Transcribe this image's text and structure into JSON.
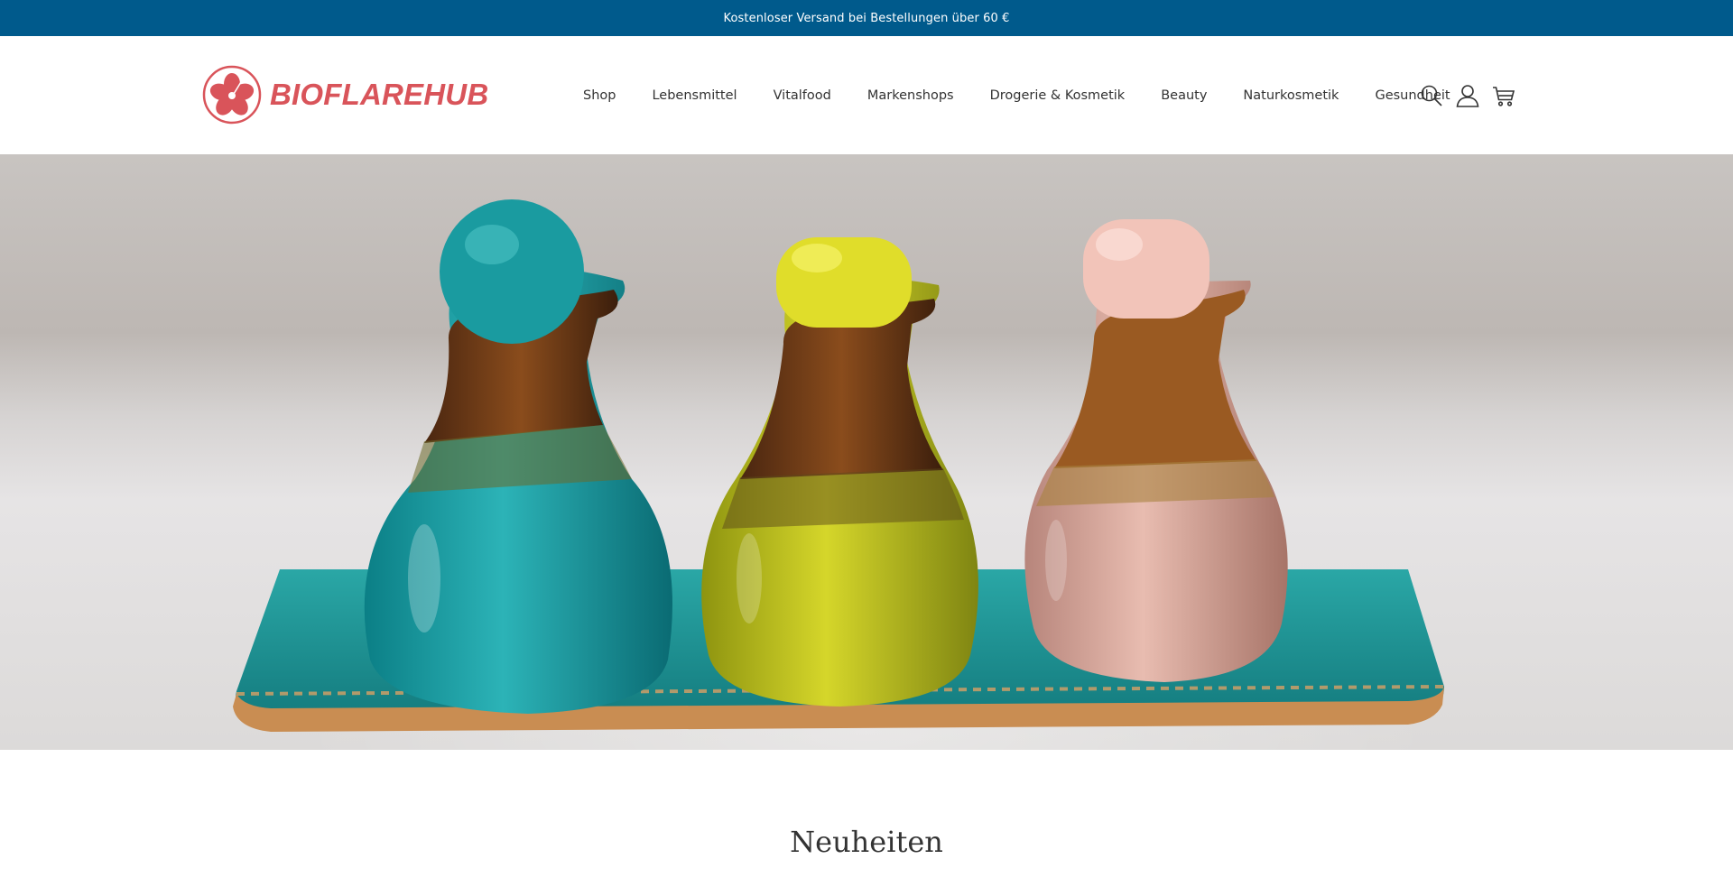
{
  "announcement": {
    "text": "Kostenloser Versand bei Bestellungen über 60 €"
  },
  "brand": {
    "name": "BIOFLAREHUB",
    "logo_icon": "hibiscus-icon",
    "color": "#d9545a"
  },
  "nav": {
    "items": [
      {
        "label": "Shop"
      },
      {
        "label": "Lebensmittel"
      },
      {
        "label": "Vitalfood"
      },
      {
        "label": "Markenshops"
      },
      {
        "label": "Drogerie & Kosmetik"
      },
      {
        "label": "Beauty"
      },
      {
        "label": "Naturkosmetik"
      },
      {
        "label": "Gesundheit"
      }
    ]
  },
  "header_icons": [
    "search-icon",
    "account-icon",
    "cart-icon"
  ],
  "hero": {
    "image": "three ceramic oil bottles (turquoise, yellow, pink) on a turquoise tray"
  },
  "sections": {
    "new_arrivals_title": "Neuheiten"
  },
  "colors": {
    "announcement_bg": "#005a8c",
    "text": "#333333"
  }
}
